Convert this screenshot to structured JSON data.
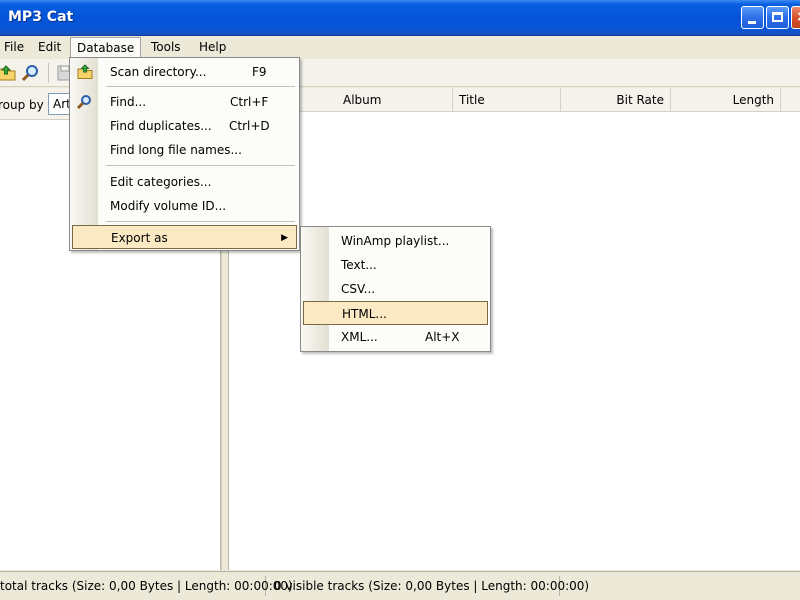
{
  "window": {
    "title": "MP3 Cat"
  },
  "menubar": {
    "items": [
      "File",
      "Edit",
      "Database",
      "Tools",
      "Help"
    ]
  },
  "toolbar": {
    "icons": [
      "open-folder-icon",
      "find-icon",
      "save-icon"
    ]
  },
  "left_panel": {
    "groupby_label": "roup by",
    "groupby_value": "Arti"
  },
  "list": {
    "columns": [
      "Album",
      "Title",
      "Bit Rate",
      "Length"
    ]
  },
  "status": {
    "left": "total tracks (Size: 0,00 Bytes | Length: 00:00:00)",
    "right": "0 visible tracks (Size: 0,00 Bytes | Length: 00:00:00)"
  },
  "database_menu": {
    "scan": {
      "label": "Scan directory...",
      "shortcut": "F9"
    },
    "find": {
      "label": "Find...",
      "shortcut": "Ctrl+F"
    },
    "duplicates": {
      "label": "Find duplicates...",
      "shortcut": "Ctrl+D"
    },
    "long_names": {
      "label": "Find long file names..."
    },
    "categories": {
      "label": "Edit categories..."
    },
    "volume": {
      "label": "Modify volume ID..."
    },
    "export": {
      "label": "Export as"
    }
  },
  "export_menu": {
    "winamp": {
      "label": "WinAmp playlist..."
    },
    "text": {
      "label": "Text..."
    },
    "csv": {
      "label": "CSV..."
    },
    "html": {
      "label": "HTML..."
    },
    "xml": {
      "label": "XML...",
      "shortcut": "Alt+X"
    }
  },
  "colors": {
    "titlebar": "#0453d8",
    "menu_highlight": "#fbe9c4",
    "menu_highlight_border": "#7a6a43"
  }
}
